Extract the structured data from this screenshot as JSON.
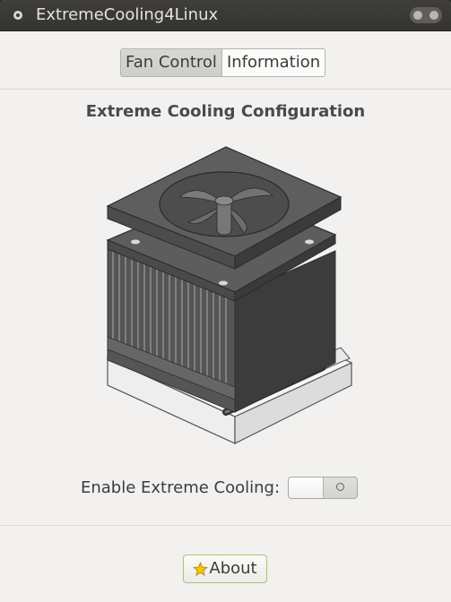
{
  "window": {
    "title": "ExtremeCooling4Linux"
  },
  "tabs": [
    {
      "label": "Fan Control",
      "active": true
    },
    {
      "label": "Information",
      "active": false
    }
  ],
  "main": {
    "heading": "Extreme Cooling Configuration",
    "illustration": "cpu-cooler-illustration",
    "enable_label": "Enable Extreme Cooling:",
    "enable_switch": {
      "state": "off"
    }
  },
  "footer": {
    "about_label": "About",
    "about_icon": "star-icon"
  },
  "colors": {
    "titlebar": "#3c3b37",
    "window_bg": "#f2f1f0",
    "about_border": "#a9c36f"
  }
}
